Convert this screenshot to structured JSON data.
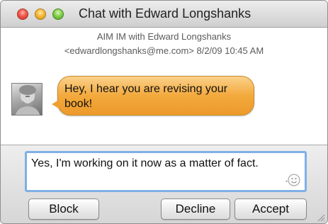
{
  "window": {
    "title": "Chat with Edward Longshanks"
  },
  "conversation": {
    "header_line1": "AIM IM with Edward Longshanks",
    "header_line2": "<edwardlongshanks@me.com>  8/2/09 10:45 AM",
    "incoming_message": "Hey, I hear you are revising your book!"
  },
  "compose": {
    "value": "Yes, I'm working on it now as a matter of fact.",
    "emoticon_icon": "smiley-icon"
  },
  "actions": {
    "block_label": "Block",
    "decline_label": "Decline",
    "accept_label": "Accept"
  },
  "colors": {
    "bubble": "#f3a93c",
    "focus_ring": "#7fb0e6"
  }
}
